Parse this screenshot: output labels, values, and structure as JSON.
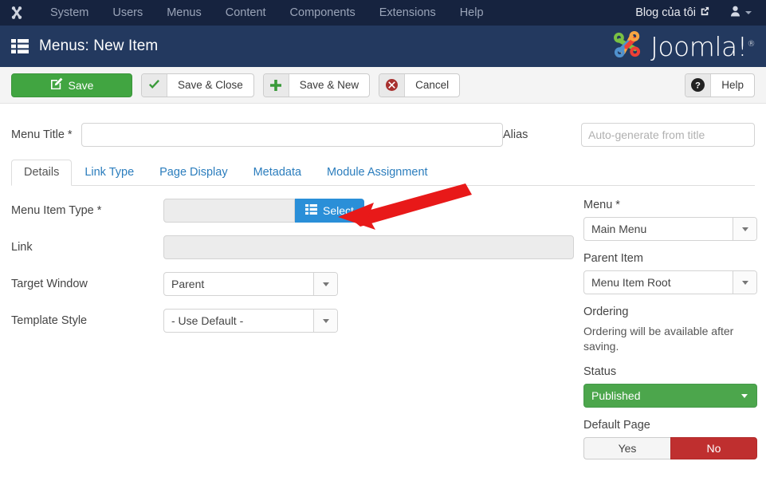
{
  "topbar": {
    "logo_icon": "joomla-mark-icon",
    "nav_items": [
      {
        "label": "System"
      },
      {
        "label": "Users"
      },
      {
        "label": "Menus"
      },
      {
        "label": "Content"
      },
      {
        "label": "Components"
      },
      {
        "label": "Extensions"
      },
      {
        "label": "Help"
      }
    ],
    "site_link": {
      "label": "Blog của tôi",
      "icon": "external-link-icon"
    },
    "user_menu": {
      "icon": "user-icon",
      "caret": "chevron-down-icon"
    }
  },
  "header": {
    "icon": "list-view-icon",
    "title": "Menus: New Item",
    "logo_text": "Joomla!",
    "logo_registered": "®"
  },
  "toolbar": {
    "save": {
      "label": "Save",
      "icon": "edit-pencil-icon"
    },
    "save_close": {
      "label": "Save & Close",
      "icon": "checkmark-icon"
    },
    "save_new": {
      "label": "Save & New",
      "icon": "plus-icon"
    },
    "cancel": {
      "label": "Cancel",
      "icon": "circle-x-icon"
    },
    "help": {
      "label": "Help",
      "icon": "question-circle-icon"
    }
  },
  "form": {
    "menu_title": {
      "label": "Menu Title *",
      "value": "",
      "placeholder": ""
    },
    "alias": {
      "label": "Alias",
      "value": "",
      "placeholder": "Auto-generate from title"
    }
  },
  "tabs": [
    {
      "label": "Details",
      "active": true
    },
    {
      "label": "Link Type",
      "active": false
    },
    {
      "label": "Page Display",
      "active": false
    },
    {
      "label": "Metadata",
      "active": false
    },
    {
      "label": "Module Assignment",
      "active": false
    }
  ],
  "details": {
    "menu_item_type": {
      "label": "Menu Item Type *",
      "value": "",
      "select_button": {
        "label": "Select",
        "icon": "list-grid-icon"
      }
    },
    "link": {
      "label": "Link",
      "value": ""
    },
    "target_window": {
      "label": "Target Window",
      "value": "Parent"
    },
    "template_style": {
      "label": "Template Style",
      "value": "- Use Default -"
    }
  },
  "sidebar": {
    "menu": {
      "label": "Menu *",
      "value": "Main Menu"
    },
    "parent_item": {
      "label": "Parent Item",
      "value": "Menu Item Root"
    },
    "ordering": {
      "label": "Ordering",
      "note": "Ordering will be available after saving."
    },
    "status": {
      "label": "Status",
      "value": "Published"
    },
    "default_page": {
      "label": "Default Page",
      "yes_label": "Yes",
      "no_label": "No",
      "selected": "No"
    }
  },
  "annotation": {
    "arrow": "red-arrow-pointing-to-select-button",
    "color": "#e81919"
  },
  "colors": {
    "topbar_bg": "#16233f",
    "header_bg": "#23395f",
    "save_green": "#41a541",
    "select_blue": "#2a8fd8",
    "status_green": "#4ca64c",
    "no_red": "#bf2f2f",
    "tab_link_blue": "#2b7dbd",
    "arrow_red": "#e81919"
  }
}
